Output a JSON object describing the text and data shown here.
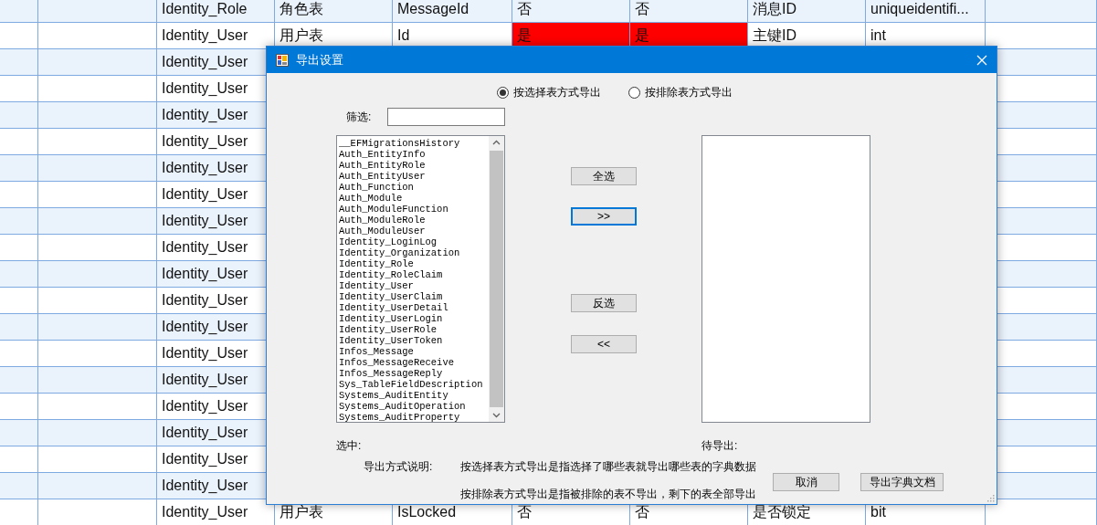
{
  "table": {
    "rows": [
      {
        "cells": [
          {
            "text": "Identity_Role",
            "highlight": false
          },
          {
            "text": "角色表",
            "highlight": false
          },
          {
            "text": "MessageId",
            "highlight": false
          },
          {
            "text": "否",
            "highlight": false
          },
          {
            "text": "否",
            "highlight": false
          },
          {
            "text": "消息ID",
            "highlight": false
          },
          {
            "text": "uniqueidentifi...",
            "highlight": false
          }
        ]
      },
      {
        "cells": [
          {
            "text": "Identity_User",
            "highlight": false
          },
          {
            "text": "用户表",
            "highlight": false
          },
          {
            "text": "Id",
            "highlight": false
          },
          {
            "text": "是",
            "highlight": true
          },
          {
            "text": "是",
            "highlight": true
          },
          {
            "text": "主键ID",
            "highlight": false
          },
          {
            "text": "int",
            "highlight": false
          }
        ]
      },
      {
        "cells": [
          {
            "text": "Identity_User",
            "highlight": false
          }
        ]
      },
      {
        "cells": [
          {
            "text": "Identity_User",
            "highlight": false
          }
        ]
      },
      {
        "cells": [
          {
            "text": "Identity_User",
            "highlight": false
          }
        ]
      },
      {
        "cells": [
          {
            "text": "Identity_User",
            "highlight": false
          }
        ]
      },
      {
        "cells": [
          {
            "text": "Identity_User",
            "highlight": false
          }
        ]
      },
      {
        "cells": [
          {
            "text": "Identity_User",
            "highlight": false
          }
        ]
      },
      {
        "cells": [
          {
            "text": "Identity_User",
            "highlight": false
          }
        ]
      },
      {
        "cells": [
          {
            "text": "Identity_User",
            "highlight": false
          }
        ]
      },
      {
        "cells": [
          {
            "text": "Identity_User",
            "highlight": false
          }
        ]
      },
      {
        "cells": [
          {
            "text": "Identity_User",
            "highlight": false
          }
        ]
      },
      {
        "cells": [
          {
            "text": "Identity_User",
            "highlight": false
          }
        ]
      },
      {
        "cells": [
          {
            "text": "Identity_User",
            "highlight": false
          }
        ]
      },
      {
        "cells": [
          {
            "text": "Identity_User",
            "highlight": false
          }
        ]
      },
      {
        "cells": [
          {
            "text": "Identity_User",
            "highlight": false
          }
        ]
      },
      {
        "cells": [
          {
            "text": "Identity_User",
            "highlight": false
          }
        ]
      },
      {
        "cells": [
          {
            "text": "Identity_User",
            "highlight": false
          }
        ]
      },
      {
        "cells": [
          {
            "text": "Identity_User",
            "highlight": false
          }
        ]
      },
      {
        "cells": [
          {
            "text": "Identity_User",
            "highlight": false
          },
          {
            "text": "用户表",
            "highlight": false
          },
          {
            "text": "IsLocked",
            "highlight": false
          },
          {
            "text": "否",
            "highlight": false
          },
          {
            "text": "否",
            "highlight": false
          },
          {
            "text": "是否锁定",
            "highlight": false
          },
          {
            "text": "bit",
            "highlight": false
          }
        ]
      }
    ]
  },
  "dialog": {
    "title": "导出设置",
    "modes": [
      {
        "label": "按选择表方式导出",
        "selected": true
      },
      {
        "label": "按排除表方式导出",
        "selected": false
      }
    ],
    "filter": {
      "label": "筛选:"
    },
    "tables": [
      "__EFMigrationsHistory",
      "Auth_EntityInfo",
      "Auth_EntityRole",
      "Auth_EntityUser",
      "Auth_Function",
      "Auth_Module",
      "Auth_ModuleFunction",
      "Auth_ModuleRole",
      "Auth_ModuleUser",
      "Identity_LoginLog",
      "Identity_Organization",
      "Identity_Role",
      "Identity_RoleClaim",
      "Identity_User",
      "Identity_UserClaim",
      "Identity_UserDetail",
      "Identity_UserLogin",
      "Identity_UserRole",
      "Identity_UserToken",
      "Infos_Message",
      "Infos_MessageReceive",
      "Infos_MessageReply",
      "Sys_TableFieldDescription",
      "Systems_AuditEntity",
      "Systems_AuditOperation",
      "Systems_AuditProperty"
    ],
    "move_buttons": [
      {
        "label": "全选",
        "focused": false
      },
      {
        "label": ">>",
        "focused": true
      },
      {
        "label": "反选",
        "focused": false
      },
      {
        "label": "<<",
        "focused": false
      }
    ],
    "selected_label": "选中:",
    "pending_label": "待导出:",
    "explain_label": "导出方式说明:",
    "explain_lines": [
      "按选择表方式导出是指选择了哪些表就导出哪些表的字典数据",
      "按排除表方式导出是指被排除的表不导出，剩下的表全部导出"
    ],
    "buttons": [
      "取消",
      "导出字典文档"
    ]
  }
}
